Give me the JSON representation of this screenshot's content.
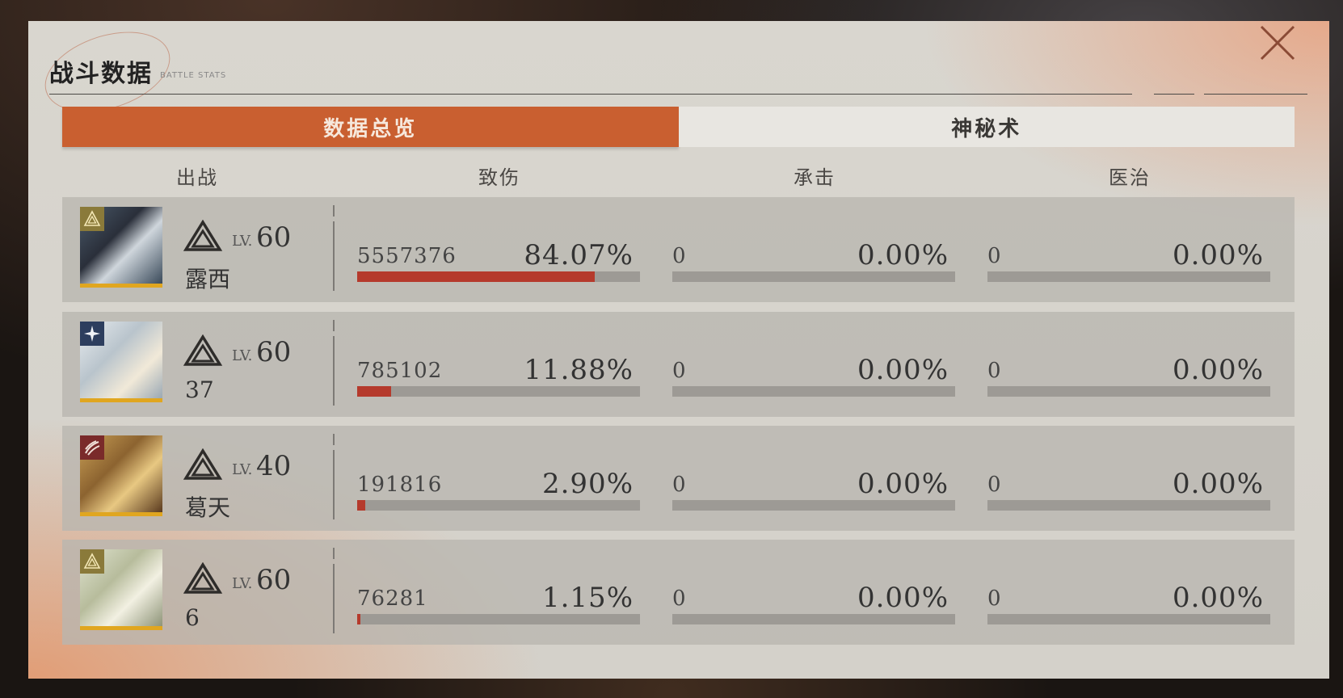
{
  "header": {
    "title": "战斗数据",
    "subtitle": "BATTLE STATS"
  },
  "tabs": [
    {
      "label": "数据总览",
      "active": true
    },
    {
      "label": "神秘术",
      "active": false
    }
  ],
  "columns": {
    "deploy": "出战",
    "damage": "致伤",
    "taken": "承击",
    "heal": "医治"
  },
  "lv_label": "LV.",
  "colors": {
    "accent": "#c95f30",
    "bar_fill": "#b53a2c",
    "bar_track": "#9d9a95",
    "portrait_border": "#e0a620"
  },
  "rows": [
    {
      "level": "60",
      "name": "露西",
      "emblem": "pyramid-emblem-icon",
      "emblem_color": "#8a7a3a",
      "damage": {
        "value": "5557376",
        "pct": "84.07%",
        "fraction": 0.8407
      },
      "taken": {
        "value": "0",
        "pct": "0.00%",
        "fraction": 0
      },
      "heal": {
        "value": "0",
        "pct": "0.00%",
        "fraction": 0
      }
    },
    {
      "level": "60",
      "name": "37",
      "emblem": "star-emblem-icon",
      "emblem_color": "#2d3e5e",
      "damage": {
        "value": "785102",
        "pct": "11.88%",
        "fraction": 0.1188
      },
      "taken": {
        "value": "0",
        "pct": "0.00%",
        "fraction": 0
      },
      "heal": {
        "value": "0",
        "pct": "0.00%",
        "fraction": 0
      }
    },
    {
      "level": "40",
      "name": "葛天",
      "emblem": "claw-emblem-icon",
      "emblem_color": "#7a2a2a",
      "damage": {
        "value": "191816",
        "pct": "2.90%",
        "fraction": 0.029
      },
      "taken": {
        "value": "0",
        "pct": "0.00%",
        "fraction": 0
      },
      "heal": {
        "value": "0",
        "pct": "0.00%",
        "fraction": 0
      }
    },
    {
      "level": "60",
      "name": "6",
      "emblem": "pyramid-emblem-icon",
      "emblem_color": "#8a7a3a",
      "damage": {
        "value": "76281",
        "pct": "1.15%",
        "fraction": 0.0115
      },
      "taken": {
        "value": "0",
        "pct": "0.00%",
        "fraction": 0
      },
      "heal": {
        "value": "0",
        "pct": "0.00%",
        "fraction": 0
      }
    }
  ]
}
